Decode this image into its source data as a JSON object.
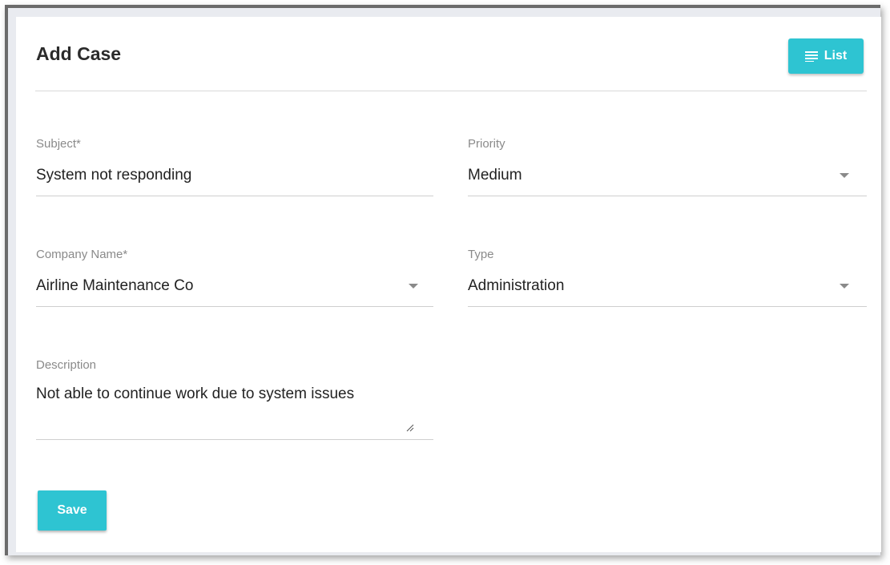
{
  "header": {
    "title": "Add Case",
    "list_button_label": "List",
    "list_icon": "list-icon"
  },
  "form": {
    "subject": {
      "label": "Subject*",
      "value": "System not responding"
    },
    "priority": {
      "label": "Priority",
      "value": "Medium"
    },
    "company_name": {
      "label": "Company Name*",
      "value": "Airline Maintenance Co"
    },
    "type": {
      "label": "Type",
      "value": "Administration"
    },
    "description": {
      "label": "Description",
      "value": "Not able to continue work due to system issues"
    }
  },
  "actions": {
    "save_label": "Save"
  },
  "colors": {
    "accent": "#2ec4d2",
    "page_background": "#e9ebf0",
    "label_text": "#8a8a8a",
    "value_text": "#222222"
  }
}
